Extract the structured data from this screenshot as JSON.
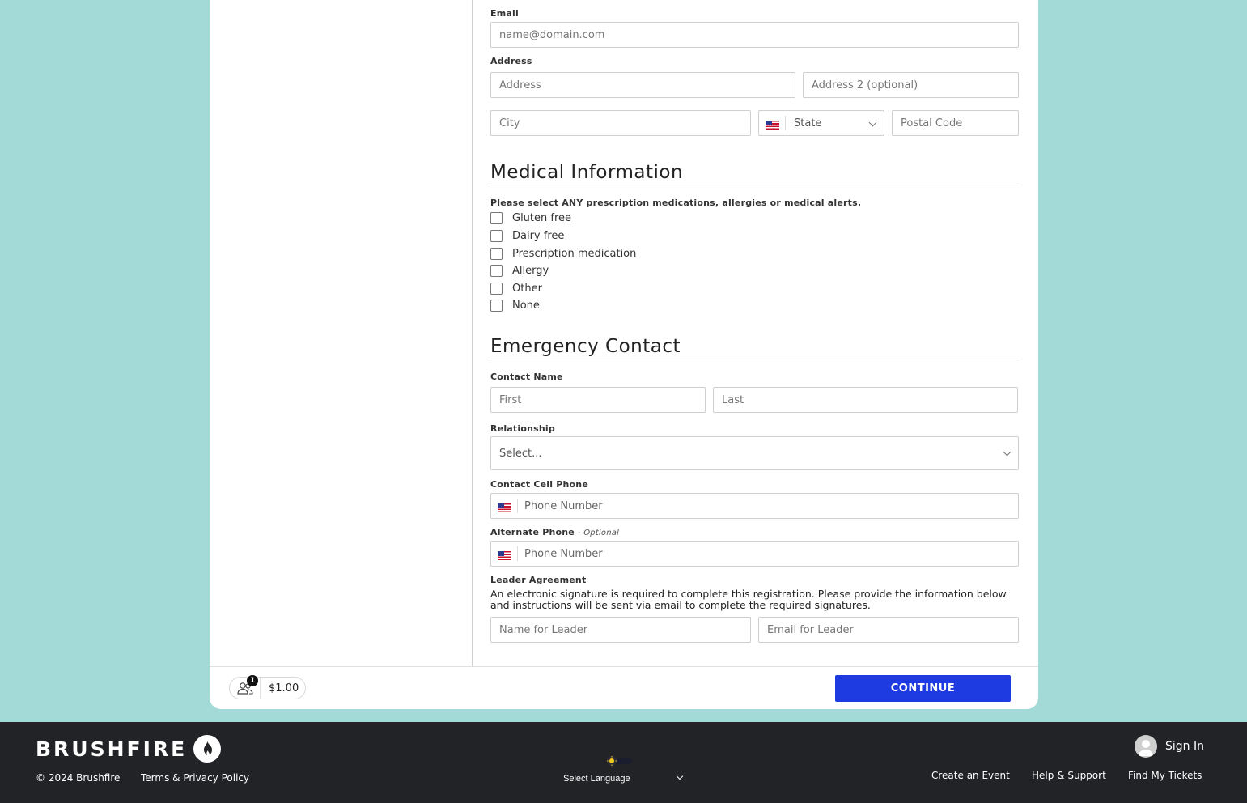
{
  "form": {
    "email": {
      "label": "Email",
      "placeholder": "name@domain.com"
    },
    "address": {
      "label": "Address",
      "address_placeholder": "Address",
      "address2_placeholder": "Address 2 (optional)",
      "city_placeholder": "City",
      "state_value": "State",
      "postal_placeholder": "Postal Code"
    },
    "medical": {
      "title": "Medical Information",
      "prompt": "Please select ANY prescription medications, allergies or medical alerts.",
      "options": [
        "Gluten free",
        "Dairy free",
        "Prescription medication",
        "Allergy",
        "Other",
        "None"
      ]
    },
    "emergency": {
      "title": "Emergency Contact",
      "contact_name_label": "Contact Name",
      "first_placeholder": "First",
      "last_placeholder": "Last",
      "relationship_label": "Relationship",
      "relationship_value": "Select...",
      "cell_label": "Contact Cell Phone",
      "phone_placeholder": "Phone Number",
      "alt_label": "Alternate Phone",
      "alt_optional": "- Optional"
    },
    "leader": {
      "label": "Leader Agreement",
      "text": "An electronic signature is required to complete this registration. Please provide the information below and instructions will be sent via email to complete the required signatures.",
      "name_placeholder": "Name for Leader",
      "email_placeholder": "Email for Leader"
    }
  },
  "cart": {
    "count": "1",
    "price": "$1.00"
  },
  "continue_label": "CONTINUE",
  "footer": {
    "logo": "BRUSHFIRE",
    "copyright": "© 2024 Brushfire",
    "terms": "Terms & Privacy Policy",
    "language": "Select Language",
    "sign_in": "Sign In",
    "links": [
      "Create an Event",
      "Help & Support",
      "Find My Tickets"
    ]
  },
  "colors": {
    "accent": "#1d3be0",
    "background": "#a3d9d6",
    "footer": "#222326"
  }
}
